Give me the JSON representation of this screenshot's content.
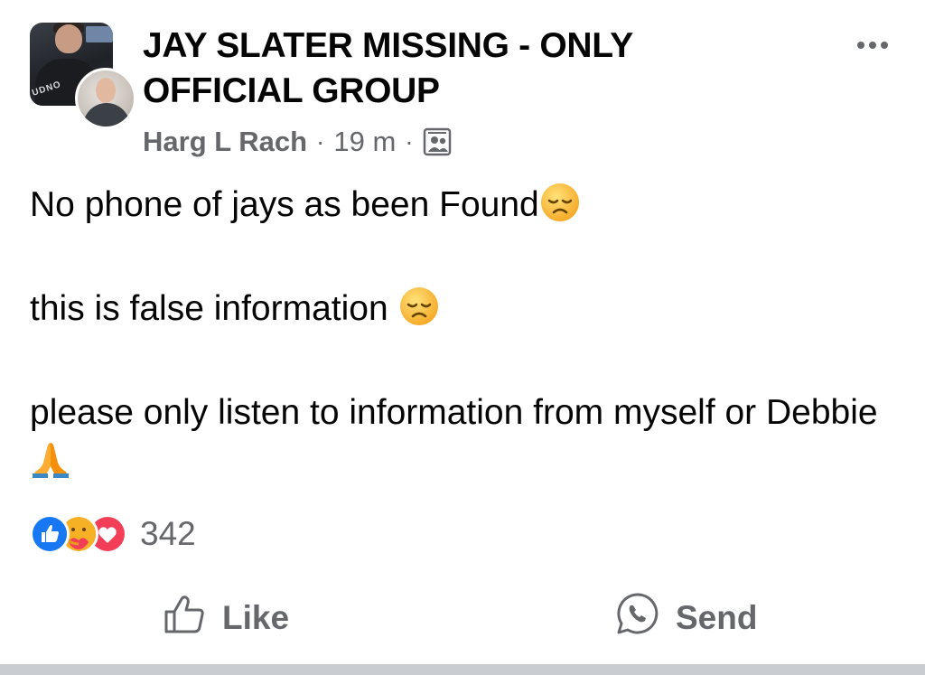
{
  "post": {
    "group_name": "JAY SLATER MISSING - ONLY OFFICIAL GROUP",
    "author": "Harg L Rach",
    "separator": "·",
    "time": "19 m",
    "audience_icon": "group-members-icon",
    "avatar_shirt_text": "UDNO",
    "body": [
      "No phone of jays as been Found",
      "this is false information ",
      "please only listen to information from myself or Debbie "
    ],
    "emojis": [
      "disappointed-face",
      "disappointed-face",
      "folded-hands"
    ]
  },
  "reactions": {
    "icons": [
      "like-reaction-icon",
      "care-reaction-icon",
      "love-reaction-icon"
    ],
    "count": "342"
  },
  "actions": {
    "like_label": "Like",
    "send_label": "Send"
  },
  "colors": {
    "secondary_text": "#65676b",
    "like_blue": "#1877f2",
    "love_red": "#f33e58",
    "care_yellow": "#f7b125"
  }
}
